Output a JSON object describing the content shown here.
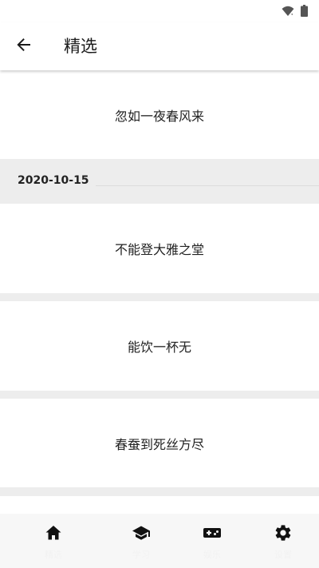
{
  "header": {
    "title": "精选"
  },
  "cards": [
    {
      "text": "忽如一夜春风来"
    },
    {
      "text": "不能登大雅之堂"
    },
    {
      "text": "能饮一杯无"
    },
    {
      "text": "春蚕到死丝方尽"
    }
  ],
  "date_header": {
    "date": "2020-10-15"
  },
  "bottom_nav": {
    "items": [
      {
        "label": "精选",
        "icon": "home-icon"
      },
      {
        "label": "学习",
        "icon": "graduation-cap-icon"
      },
      {
        "label": "娱乐",
        "icon": "gamepad-icon"
      },
      {
        "label": "设置",
        "icon": "gear-icon"
      }
    ]
  },
  "colors": {
    "background": "#ededed",
    "card": "#ffffff",
    "nav_background": "#f7f7f7",
    "icon": "#111111"
  }
}
